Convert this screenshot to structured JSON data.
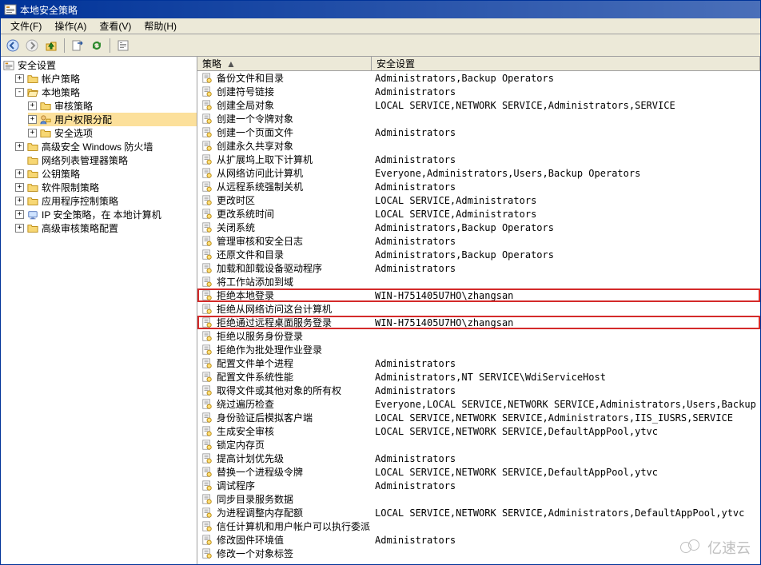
{
  "window": {
    "title": "本地安全策略"
  },
  "menu": {
    "file": "文件(F)",
    "action": "操作(A)",
    "view": "查看(V)",
    "help": "帮助(H)"
  },
  "toolbar": {
    "back": "back-icon",
    "forward": "forward-icon",
    "up": "up-icon",
    "export": "export-icon",
    "refresh": "refresh-icon",
    "properties": "properties-icon"
  },
  "tree": {
    "root": "安全设置",
    "items": [
      {
        "label": "帐户策略",
        "icon": "folder",
        "expandable": true
      },
      {
        "label": "本地策略",
        "icon": "folder",
        "expanded": true,
        "children": [
          {
            "label": "审核策略",
            "icon": "folder",
            "expandable": true
          },
          {
            "label": "用户权限分配",
            "icon": "user-rights",
            "selected": true,
            "expandable": true
          },
          {
            "label": "安全选项",
            "icon": "folder",
            "expandable": true
          }
        ]
      },
      {
        "label": "高级安全 Windows 防火墙",
        "icon": "folder",
        "expandable": true
      },
      {
        "label": "网络列表管理器策略",
        "icon": "folder"
      },
      {
        "label": "公钥策略",
        "icon": "folder",
        "expandable": true
      },
      {
        "label": "软件限制策略",
        "icon": "folder",
        "expandable": true
      },
      {
        "label": "应用程序控制策略",
        "icon": "folder",
        "expandable": true
      },
      {
        "label": "IP 安全策略，在 本地计算机",
        "icon": "ipsec",
        "expandable": true
      },
      {
        "label": "高级审核策略配置",
        "icon": "folder",
        "expandable": true
      }
    ]
  },
  "columns": {
    "policy": "策略",
    "setting": "安全设置",
    "sort_indicator": "▲"
  },
  "policies": [
    {
      "name": "备份文件和目录",
      "setting": "Administrators,Backup Operators"
    },
    {
      "name": "创建符号链接",
      "setting": "Administrators"
    },
    {
      "name": "创建全局对象",
      "setting": "LOCAL SERVICE,NETWORK SERVICE,Administrators,SERVICE"
    },
    {
      "name": "创建一个令牌对象",
      "setting": ""
    },
    {
      "name": "创建一个页面文件",
      "setting": "Administrators"
    },
    {
      "name": "创建永久共享对象",
      "setting": ""
    },
    {
      "name": "从扩展坞上取下计算机",
      "setting": "Administrators"
    },
    {
      "name": "从网络访问此计算机",
      "setting": "Everyone,Administrators,Users,Backup Operators"
    },
    {
      "name": "从远程系统强制关机",
      "setting": "Administrators"
    },
    {
      "name": "更改时区",
      "setting": "LOCAL SERVICE,Administrators"
    },
    {
      "name": "更改系统时间",
      "setting": "LOCAL SERVICE,Administrators"
    },
    {
      "name": "关闭系统",
      "setting": "Administrators,Backup Operators"
    },
    {
      "name": "管理审核和安全日志",
      "setting": "Administrators"
    },
    {
      "name": "还原文件和目录",
      "setting": "Administrators,Backup Operators"
    },
    {
      "name": "加载和卸载设备驱动程序",
      "setting": "Administrators"
    },
    {
      "name": "将工作站添加到域",
      "setting": ""
    },
    {
      "name": "拒绝本地登录",
      "setting": "WIN-H751405U7HO\\zhangsan",
      "highlight": true
    },
    {
      "name": "拒绝从网络访问这台计算机",
      "setting": ""
    },
    {
      "name": "拒绝通过远程桌面服务登录",
      "setting": "WIN-H751405U7HO\\zhangsan",
      "highlight": true
    },
    {
      "name": "拒绝以服务身份登录",
      "setting": ""
    },
    {
      "name": "拒绝作为批处理作业登录",
      "setting": ""
    },
    {
      "name": "配置文件单个进程",
      "setting": "Administrators"
    },
    {
      "name": "配置文件系统性能",
      "setting": "Administrators,NT SERVICE\\WdiServiceHost"
    },
    {
      "name": "取得文件或其他对象的所有权",
      "setting": "Administrators"
    },
    {
      "name": "绕过遍历检查",
      "setting": "Everyone,LOCAL SERVICE,NETWORK SERVICE,Administrators,Users,Backup Operators"
    },
    {
      "name": "身份验证后模拟客户端",
      "setting": "LOCAL SERVICE,NETWORK SERVICE,Administrators,IIS_IUSRS,SERVICE"
    },
    {
      "name": "生成安全审核",
      "setting": "LOCAL SERVICE,NETWORK SERVICE,DefaultAppPool,ytvc"
    },
    {
      "name": "锁定内存页",
      "setting": ""
    },
    {
      "name": "提高计划优先级",
      "setting": "Administrators"
    },
    {
      "name": "替换一个进程级令牌",
      "setting": "LOCAL SERVICE,NETWORK SERVICE,DefaultAppPool,ytvc"
    },
    {
      "name": "调试程序",
      "setting": "Administrators"
    },
    {
      "name": "同步目录服务数据",
      "setting": ""
    },
    {
      "name": "为进程调整内存配额",
      "setting": "LOCAL SERVICE,NETWORK SERVICE,Administrators,DefaultAppPool,ytvc"
    },
    {
      "name": "信任计算机和用户帐户可以执行委派",
      "setting": ""
    },
    {
      "name": "修改固件环境值",
      "setting": "Administrators"
    },
    {
      "name": "修改一个对象标签",
      "setting": ""
    }
  ],
  "watermark": {
    "text": "亿速云"
  }
}
